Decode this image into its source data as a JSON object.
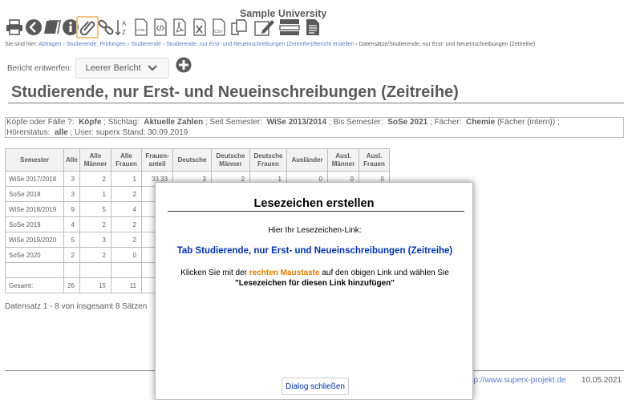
{
  "app": {
    "title": "Sample University"
  },
  "toolbar": {
    "icons": [
      "printer-icon",
      "back-icon",
      "books-icon",
      "info-icon",
      "bookmark-icon",
      "link-icon",
      "sort-icon",
      "html-icon",
      "xml-icon",
      "pdf-icon",
      "excel-icon",
      "csv-icon",
      "copy-icon",
      "edit-icon",
      "layout-icon",
      "document-icon"
    ],
    "html_label": "HTML",
    "csv_label": "CSV"
  },
  "breadcrumb": {
    "prefix": "Sie sind hier:",
    "items": [
      "Abfragen",
      "Studierende, Prüfungen",
      "Studierende",
      "Studierende, nur Erst- und Neueinschreibungen (Zeitreihe)/Bericht erstellen"
    ],
    "current": "Datensätze/Studierende, nur Erst- und Neueinschreibungen (Zeitreihe)"
  },
  "report": {
    "label": "Bericht entwerfen:",
    "select_value": "Leerer Bericht"
  },
  "page_title": "Studierende, nur Erst- und Neueinschreibungen (Zeitreihe)",
  "filter": {
    "l1_a": "Köpfe oder Fälle ?:",
    "l1_b": "Köpfe",
    "l1_c": "; Stichtag:",
    "l1_d": "Aktuelle Zahlen",
    "l1_e": "; Seit Semester:",
    "l1_f": "WiSe 2013/2014",
    "l1_g": "; Bis Semester:",
    "l1_h": "SoSe 2021",
    "l1_i": "; Fächer:",
    "l1_j": "Chemie",
    "l1_k": "(Fächer (intern)) ;",
    "l2_a": "Hörerstatus:",
    "l2_b": "alle",
    "l2_c": "; User: superx  Stand: 30.09.2019"
  },
  "table": {
    "headers": [
      "Semester",
      "Alle",
      "Alle Männer",
      "Alle Frauen",
      "Frauen-anteil",
      "Deutsche",
      "Deutsche Männer",
      "Deutsche Frauen",
      "Ausländer",
      "Ausl. Männer",
      "Ausl. Frauen"
    ],
    "rows": [
      [
        "WiSe 2017/2018",
        "3",
        "2",
        "1",
        "33.33",
        "3",
        "2",
        "1",
        "0",
        "0",
        "0"
      ],
      [
        "SoSe 2018",
        "3",
        "1",
        "2",
        "",
        "",
        "",
        "",
        "",
        "",
        ""
      ],
      [
        "WiSe 2018/2019",
        "9",
        "5",
        "4",
        "",
        "",
        "",
        "",
        "",
        "",
        ""
      ],
      [
        "SoSe 2019",
        "4",
        "2",
        "2",
        "",
        "",
        "",
        "",
        "",
        "",
        ""
      ],
      [
        "WiSe 2019/2020",
        "5",
        "3",
        "2",
        "",
        "",
        "",
        "",
        "",
        "",
        ""
      ],
      [
        "SoSe 2020",
        "2",
        "2",
        "0",
        "",
        "",
        "",
        "",
        "",
        "",
        ""
      ],
      [
        "",
        "",
        "",
        "",
        "",
        "",
        "",
        "",
        "",
        "",
        ""
      ],
      [
        "Gesamt:",
        "26",
        "15",
        "11",
        "",
        "",
        "",
        "",
        "",
        "",
        ""
      ]
    ]
  },
  "datensatz": "Datensatz 1 - 8 von insgesamt 8 Sätzen",
  "footer": {
    "link": "ttp://www.superx-projekt.de",
    "date": "10.05.2021"
  },
  "dialog": {
    "title": "Lesezeichen erstellen",
    "hint": "Hier Ihr Lesezeichen-Link:",
    "link_text": "Tab Studierende, nur Erst- und Neueinschreibungen (Zeitreihe)",
    "instr_a": "Klicken Sie mit der",
    "instr_hl": "rechten Maustaste",
    "instr_b": "auf den obigen Link und wählen Sie",
    "instr_c": "\"Lesezeichen für diesen Link hinzufügen\"",
    "close_label": "Dialog schließen"
  },
  "colors": {
    "link": "#0033aa",
    "highlight": "#e07b00",
    "active_border": "#f0a040"
  }
}
